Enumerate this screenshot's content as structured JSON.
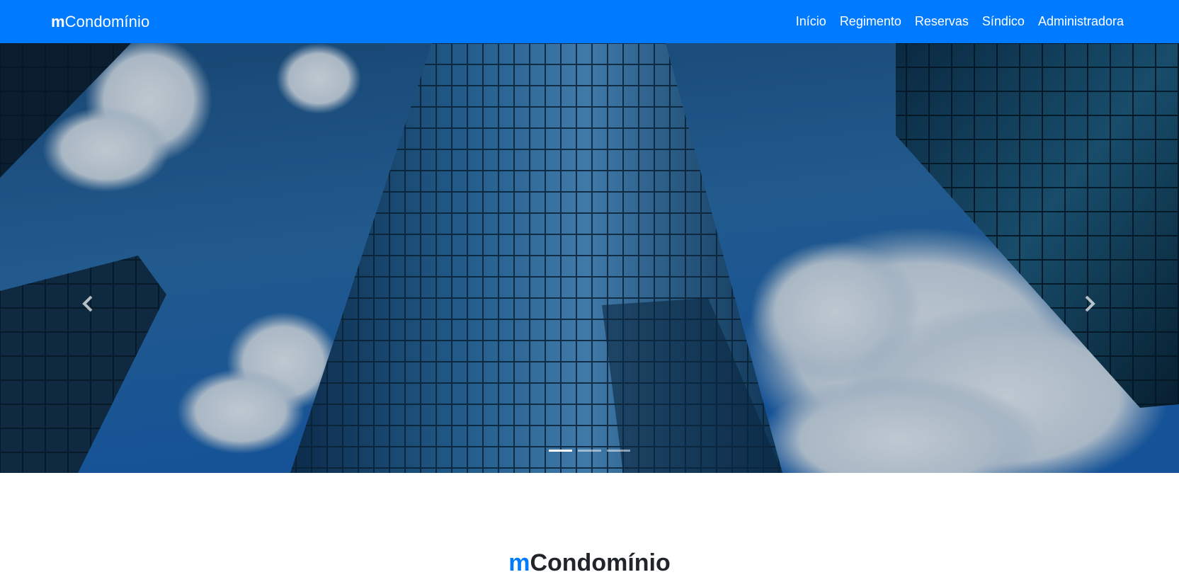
{
  "navbar": {
    "brand_prefix": "m",
    "brand_rest": "Condomínio",
    "links": [
      "Início",
      "Regimento",
      "Reservas",
      "Síndico",
      "Administradora"
    ]
  },
  "carousel": {
    "slide_count": 3,
    "active_index": 0,
    "prev_icon": "chevron-left-icon",
    "next_icon": "chevron-right-icon",
    "image_description": "low-angle view of glass skyscrapers against a blue sky with clouds"
  },
  "section": {
    "title_prefix": "m",
    "title_rest": "Condomínio"
  },
  "colors": {
    "primary": "#007bff",
    "heading": "#212529"
  }
}
